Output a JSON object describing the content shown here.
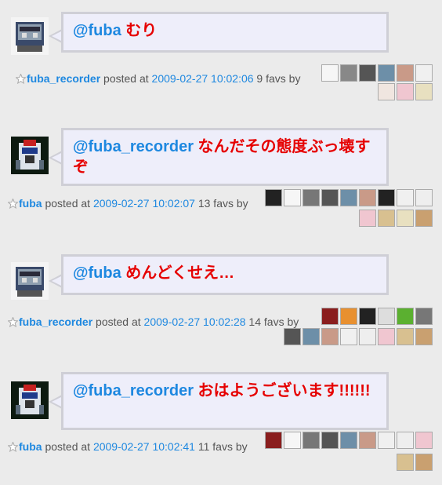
{
  "colors": {
    "mention": "#1e88e0",
    "message": "#e60000",
    "link": "#1e88e0",
    "meta": "#555555",
    "bubble_bg": "#eeeefa",
    "bubble_border": "#cfcfd6"
  },
  "posts": [
    {
      "avatar_icon": "robot-boombox-avatar-icon",
      "mention": "@fuba",
      "text": " むり",
      "user": "fuba_recorder",
      "posted_at_label": " posted at ",
      "timestamp": "2009-02-27 10:02:06",
      "favs": " 9 favs by",
      "fav_count": 9
    },
    {
      "avatar_icon": "robot-police-avatar-icon",
      "mention": "@fuba_recorder",
      "text": " なんだその態度ぶっ壊すぞ",
      "user": "fuba",
      "posted_at_label": " posted at ",
      "timestamp": "2009-02-27 10:02:07",
      "favs": " 13 favs by",
      "fav_count": 13
    },
    {
      "avatar_icon": "robot-boombox-avatar-icon",
      "mention": "@fuba",
      "text": " めんどくせえ…",
      "user": "fuba_recorder",
      "posted_at_label": " posted at ",
      "timestamp": "2009-02-27 10:02:28",
      "favs": " 14 favs by",
      "fav_count": 14
    },
    {
      "avatar_icon": "robot-police-avatar-icon",
      "mention": "@fuba_recorder",
      "text": " おはようございます!!!!!!",
      "user": "fuba",
      "posted_at_label": " posted at ",
      "timestamp": "2009-02-27 10:02:41",
      "favs": " 11 favs by",
      "fav_count": 11
    }
  ]
}
